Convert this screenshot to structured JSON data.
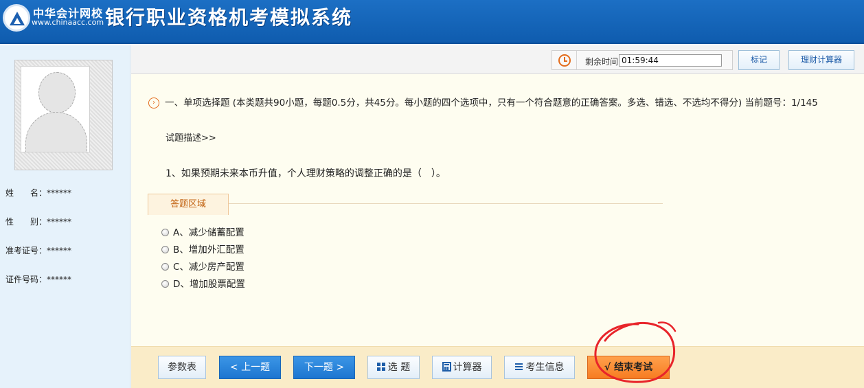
{
  "header": {
    "brand_cn": "中华会计网校",
    "brand_url": "www.chinaacc.com",
    "system_title": "银行职业资格机考模拟系统"
  },
  "sidebar": {
    "fields": [
      {
        "label": "姓　　名：",
        "value": "******"
      },
      {
        "label": "性　　别：",
        "value": "******"
      },
      {
        "label": "准考证号：",
        "value": "******"
      },
      {
        "label": "证件号码：",
        "value": "******"
      }
    ]
  },
  "topbar": {
    "timer_label": "剩余时间",
    "timer_value": "01:59:44",
    "mark_label": "标记",
    "calculator_label": "理财计算器"
  },
  "question": {
    "section_header": "一、单项选择题 (本类题共90小题，每题0.5分，共45分。每小题的四个选项中，只有一个符合题意的正确答案。多选、错选、不选均不得分) 当前题号：1/145",
    "description_link": "试题描述>>",
    "text": "1、如果预期未来本币升值，个人理财策略的调整正确的是（　）。",
    "answer_area_label": "答题区域",
    "options": [
      {
        "label": "A、减少储蓄配置"
      },
      {
        "label": "B、增加外汇配置"
      },
      {
        "label": "C、减少房产配置"
      },
      {
        "label": "D、增加股票配置"
      }
    ]
  },
  "bottombar": {
    "params_label": "参数表",
    "prev_label": "< 上一题",
    "next_label": "下一题 >",
    "select_label": "选 题",
    "calculator_label": "计算器",
    "examinee_info_label": "考生信息",
    "end_exam_label": "√ 结束考试"
  },
  "colors": {
    "header_blue": "#1565c0",
    "accent_orange": "#f77c22",
    "annotation_red": "#e8242a"
  }
}
